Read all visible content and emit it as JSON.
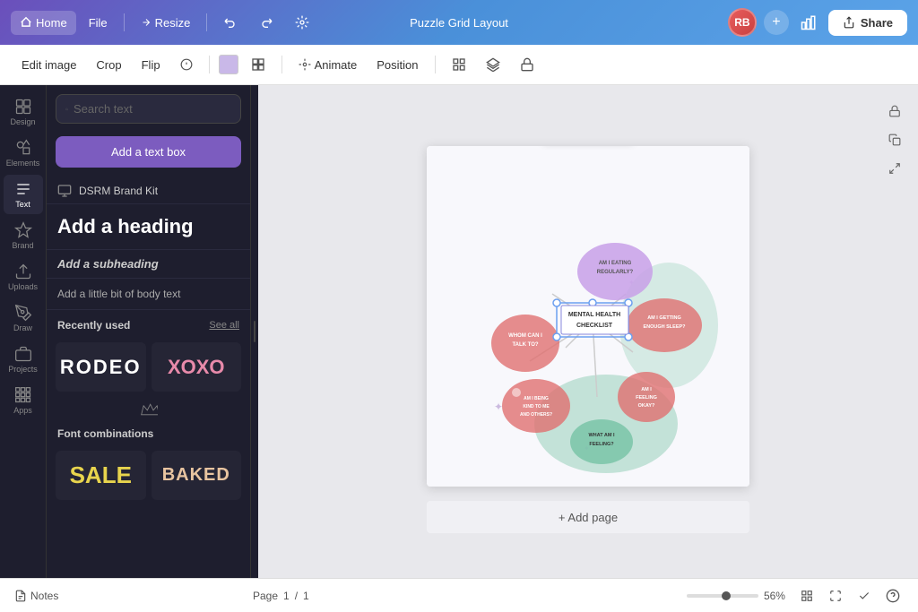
{
  "topnav": {
    "home": "Home",
    "file": "File",
    "resize": "Resize",
    "title": "Puzzle Grid Layout",
    "share": "Share",
    "avatar_initials": "RB",
    "chart_icon": "📊"
  },
  "edit_toolbar": {
    "edit_image": "Edit image",
    "crop": "Crop",
    "flip": "Flip",
    "animate": "Animate",
    "position": "Position"
  },
  "icon_sidebar": {
    "items": [
      {
        "id": "design",
        "label": "Design",
        "icon": "design"
      },
      {
        "id": "elements",
        "label": "Elements",
        "icon": "elements"
      },
      {
        "id": "text",
        "label": "Text",
        "icon": "text"
      },
      {
        "id": "brand",
        "label": "Brand",
        "icon": "brand"
      },
      {
        "id": "uploads",
        "label": "Uploads",
        "icon": "uploads"
      },
      {
        "id": "draw",
        "label": "Draw",
        "icon": "draw"
      },
      {
        "id": "projects",
        "label": "Projects",
        "icon": "projects"
      },
      {
        "id": "apps",
        "label": "Apps",
        "icon": "apps"
      }
    ]
  },
  "text_panel": {
    "search_placeholder": "Search text",
    "add_text_box": "Add a text box",
    "brand_kit": "DSRM Brand Kit",
    "heading": "Add a heading",
    "subheading": "Add a subheading",
    "body_text": "Add a little bit of body text",
    "recently_used": "Recently used",
    "see_all": "See all",
    "font_cards": [
      {
        "id": "rodeo",
        "text": "RODEO",
        "style": "rodeo"
      },
      {
        "id": "xoxo",
        "text": "XOXO",
        "style": "xoxo"
      }
    ],
    "font_combinations": "Font combinations",
    "font_combo_cards": [
      {
        "id": "sale",
        "text": "SALE",
        "style": "sale"
      },
      {
        "id": "baked",
        "text": "BAKED",
        "style": "baked"
      }
    ]
  },
  "canvas": {
    "add_page": "+ Add page",
    "float_toolbar_icons": [
      "copy",
      "delete",
      "more"
    ]
  },
  "bottom_bar": {
    "notes": "Notes",
    "page_label": "Page",
    "page_current": "1",
    "page_total": "1",
    "zoom_percent": "56%"
  },
  "mindmap": {
    "title": "MENTAL HEALTH CHECKLIST",
    "nodes": [
      {
        "id": "eating",
        "text": "AM I EATING REGULARLY?",
        "color": "#e88a5c"
      },
      {
        "id": "talking",
        "text": "WHOM CAN I TALK TO?",
        "color": "#8e7bc4"
      },
      {
        "id": "sleep",
        "text": "AM I GETTING ENOUGH SLEEP?",
        "color": "#e88a5c"
      },
      {
        "id": "kind",
        "text": "AM I BEING KIND TO ME AND OTHERS?",
        "color": "#e88a5c"
      },
      {
        "id": "feeling_ok",
        "text": "AM I FEELING OKAY?",
        "color": "#e88a5c"
      },
      {
        "id": "feeling_what",
        "text": "WHAT AM I FEELING?",
        "color": "#a0d4c0"
      }
    ]
  }
}
